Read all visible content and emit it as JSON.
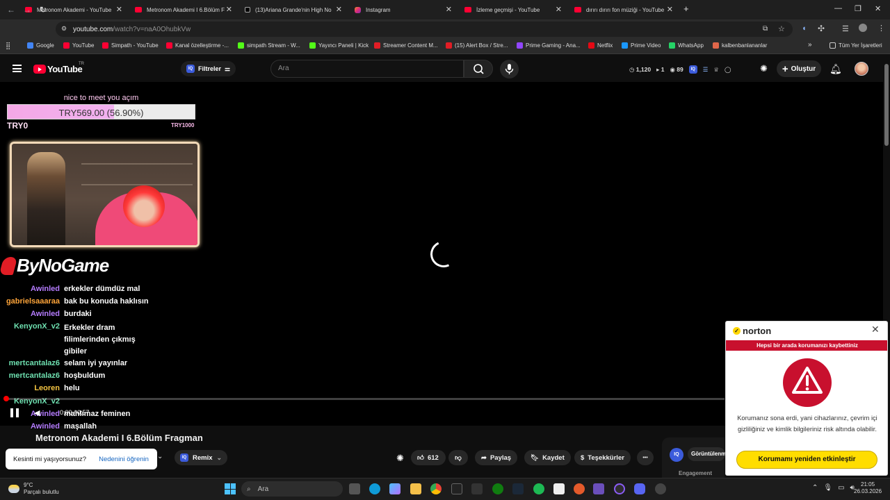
{
  "browser": {
    "tabs": [
      {
        "title": "Metronom Akademi - YouTube",
        "icon": "youtube-icon"
      },
      {
        "title": "Metronom Akademi I 6.Bölüm F",
        "icon": "youtube-icon"
      },
      {
        "title": "(13)Ariana Grande'nin High No",
        "icon": "tiktok-icon"
      },
      {
        "title": "Instagram",
        "icon": "instagram-icon"
      },
      {
        "title": "İzleme geçmişi - YouTube",
        "icon": "youtube-icon"
      },
      {
        "title": "dırırı dırırı fon müziği - YouTube",
        "icon": "youtube-icon"
      }
    ],
    "new_tab": "+",
    "url_host": "youtube.com",
    "url_path": "/watch?v=naA0OhubkVw",
    "bookmarks": [
      {
        "label": "Google",
        "color": "#4285f4"
      },
      {
        "label": "YouTube",
        "color": "#ff0033"
      },
      {
        "label": "Simpath - YouTube",
        "color": "#ff0033"
      },
      {
        "label": "Kanal özelleştirme -...",
        "color": "#ff0033"
      },
      {
        "label": "simpath Stream - W...",
        "color": "#53fc18"
      },
      {
        "label": "Yayıncı Paneli | Kick",
        "color": "#53fc18"
      },
      {
        "label": "Streamer Content M...",
        "color": "#e11d25"
      },
      {
        "label": "(15) Alert Box / Stre...",
        "color": "#e11d25"
      },
      {
        "label": "Prime Gaming - Ana...",
        "color": "#9146ff"
      },
      {
        "label": "Netflix",
        "color": "#e50914"
      },
      {
        "label": "Prime Video",
        "color": "#1a98ff"
      },
      {
        "label": "WhatsApp",
        "color": "#25d366"
      },
      {
        "label": "kalbenbanlananlar",
        "color": "#e0664a"
      }
    ],
    "bookmarks_overflow": "»",
    "all_bookmarks": "Tüm Yer İşaretleri"
  },
  "youtube": {
    "logo_text": "YouTube",
    "country_code": "TR",
    "filter_label": "Filtreler",
    "search_placeholder": "Ara",
    "stats": {
      "a": "1,120",
      "b": "1",
      "c": "89"
    },
    "create_label": "Oluştur"
  },
  "overlay": {
    "goal_title": "nice to meet you açım",
    "goal_text": "TRY569.00 (56.90%)",
    "goal_fraction": 0.569,
    "goal_min": "TRY0",
    "goal_max": "TRY1000",
    "sponsor": "ByNoGame"
  },
  "chat": [
    {
      "user": "Awinled",
      "msg": "erkekler dümdüz mal",
      "color": "#b57cff"
    },
    {
      "user": "gabrielsaaaraa",
      "msg": "bak bu konuda haklısın",
      "color": "#ffa53a"
    },
    {
      "user": "Awinled",
      "msg": "burdaki",
      "color": "#b57cff"
    },
    {
      "user": "KenyonX_v2",
      "msg": "Erkekler dram filimlerinden çıkmış gibiler",
      "color": "#6ee0b0"
    },
    {
      "user": "mertcantalaz6",
      "msg": "selam iyi yayınlar",
      "color": "#6ee0b0"
    },
    {
      "user": "mertcantalaz6",
      "msg": "hoşbuldum",
      "color": "#6ee0b0"
    },
    {
      "user": "Leoren",
      "msg": "helu",
      "color": "#f5c542"
    },
    {
      "user": "KenyonX_v2",
      "msg": "",
      "color": "#6ee0b0"
    },
    {
      "user": "Awinled",
      "msg": "mahlımaz feminen",
      "color": "#b57cff"
    },
    {
      "user": "Awinled",
      "msg": "maşallah",
      "color": "#b57cff"
    }
  ],
  "player": {
    "timecode": "0:00 / 0:57",
    "progress_fraction": 0.0
  },
  "video": {
    "title": "Metronom Akademi I 6.Bölüm Fragman",
    "remix_label": "Remix",
    "like_count": "612",
    "share_label": "Paylaş",
    "save_label": "Kaydet",
    "thanks_label": "Teşekkürler",
    "more_label": "•••",
    "views_label": "Görüntülenme",
    "engagement_label": "Engagement"
  },
  "tooltip": {
    "question": "Kesinti mi yaşıyorsunuz?",
    "link": "Nedenini öğrenin"
  },
  "norton": {
    "brand": "norton",
    "banner": "Hepsi bir arada korumanızı kaybettiniz",
    "body": "Korumanız sona erdi, yani cihazlarınız, çevrim içi gizliliğiniz ve kimlik bilgileriniz risk altında olabilir.",
    "button": "Korumamı yeniden etkinleştir",
    "accent": "#c8102e",
    "button_color": "#ffdd00"
  },
  "taskbar": {
    "temp": "9°C",
    "weather": "Parçalı bulutlu",
    "search_placeholder": "Ara",
    "time": "21:05",
    "date": "26.03.2026"
  }
}
